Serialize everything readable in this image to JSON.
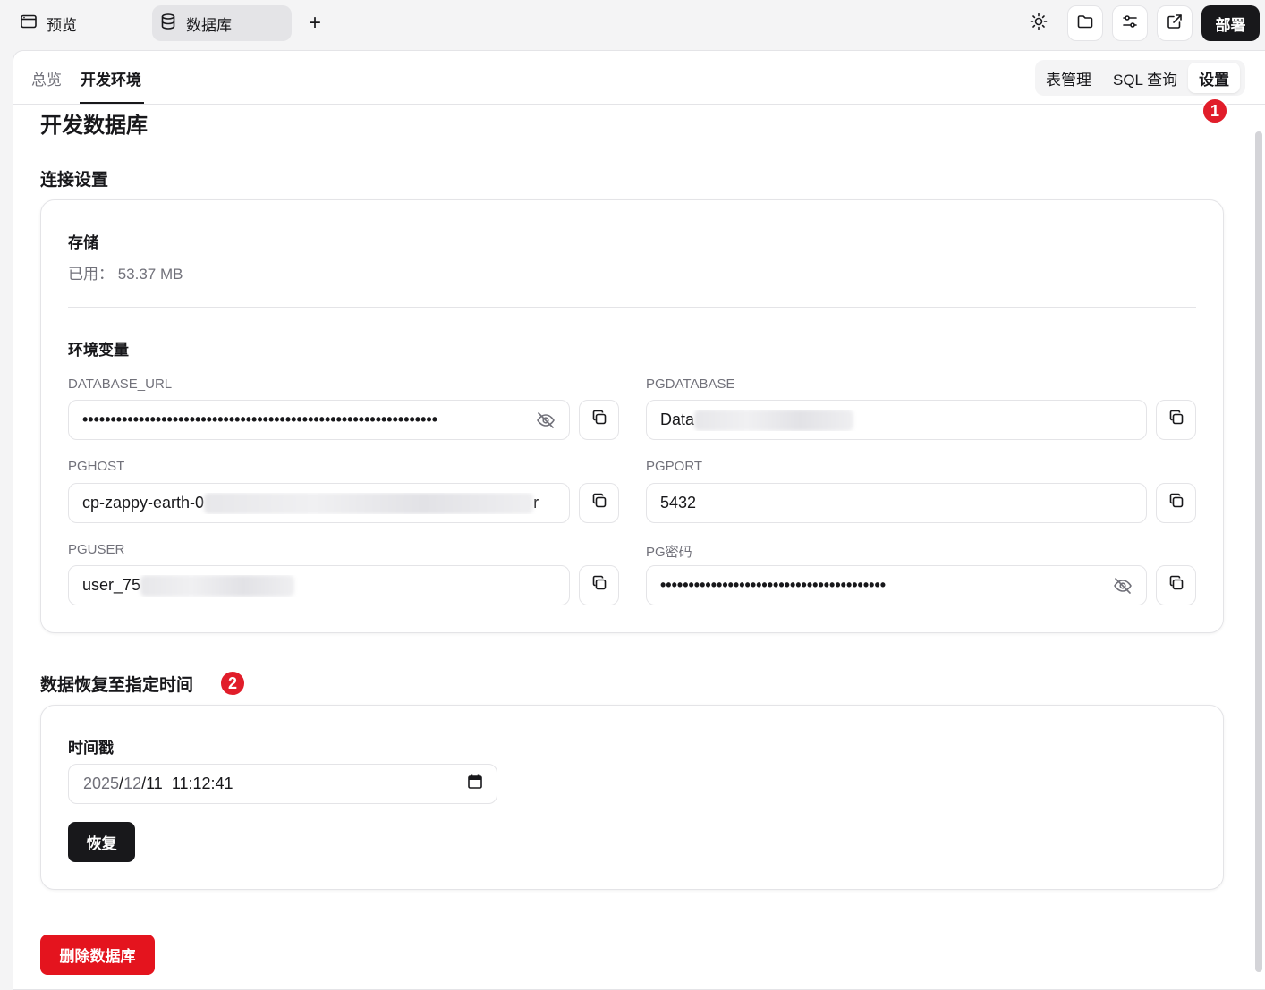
{
  "topbar": {
    "tabs": [
      {
        "label": "预览",
        "icon": "browser-window-icon",
        "active": false
      },
      {
        "label": "数据库",
        "icon": "database-icon",
        "active": true
      }
    ],
    "add_tab_label": "+",
    "actions": [
      "sun-icon",
      "folder-icon",
      "sliders-icon",
      "external-link-icon"
    ],
    "deploy_label": "部署"
  },
  "subnav": {
    "tabs": [
      "总览",
      "开发环境"
    ],
    "active_tab": "开发环境",
    "segments": [
      "表管理",
      "SQL 查询",
      "设置"
    ],
    "active_segment": "设置"
  },
  "annotations": [
    "1",
    "2"
  ],
  "page_title": "开发数据库",
  "connection": {
    "heading": "连接设置",
    "storage_title": "存储",
    "storage_used": "已用： 53.37 MB",
    "env_title": "环境变量",
    "fields": {
      "database_url": {
        "label": "DATABASE_URL",
        "value": "•••••••••••••••••••••••••••••••••••••••••••••••••••••••••••••••"
      },
      "pgdatabase": {
        "label": "PGDATABASE",
        "value": "Data"
      },
      "pghost": {
        "label": "PGHOST",
        "value": "cp-zappy-earth-0",
        "tail": "r"
      },
      "pgport": {
        "label": "PGPORT",
        "value": "5432"
      },
      "pguser": {
        "label": "PGUSER",
        "value": "user_75"
      },
      "pgpassword": {
        "label": "PG密码",
        "value": "••••••••••••••••••••••••••••••••••••••••"
      }
    }
  },
  "restore": {
    "heading": "数据恢复至指定时间",
    "timestamp_label": "时间戳",
    "date_year": "2025",
    "date_sep": "/",
    "date_month": "12",
    "date_day": "11",
    "time": "11:12:41",
    "restore_label": "恢复"
  },
  "delete_label": "删除数据库",
  "colors": {
    "accent_dark": "#18181b",
    "danger": "#e4141e",
    "badge": "#e11d2a"
  }
}
